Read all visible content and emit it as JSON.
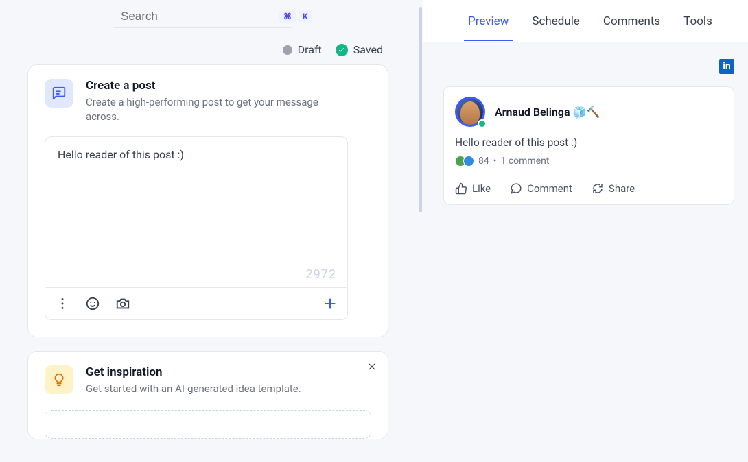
{
  "search": {
    "placeholder": "Search",
    "kbd1": "⌘",
    "kbd2": "K"
  },
  "status": {
    "draft": "Draft",
    "saved": "Saved"
  },
  "compose": {
    "title": "Create a post",
    "subtitle": "Create a high-performing post to get your message across.",
    "text": "Hello reader of this post :)",
    "char_count": "2972"
  },
  "inspire": {
    "title": "Get inspiration",
    "subtitle": "Get started with an AI-generated idea template."
  },
  "tabs": [
    "Preview",
    "Schedule",
    "Comments",
    "Tools"
  ],
  "active_tab_index": 0,
  "linkedin_label": "in",
  "preview": {
    "author": "Arnaud Belinga 🧊🔨",
    "body": "Hello reader of this post :)",
    "reactions_count": "84",
    "comments_label": "1 comment",
    "like": "Like",
    "comment": "Comment",
    "share": "Share"
  }
}
